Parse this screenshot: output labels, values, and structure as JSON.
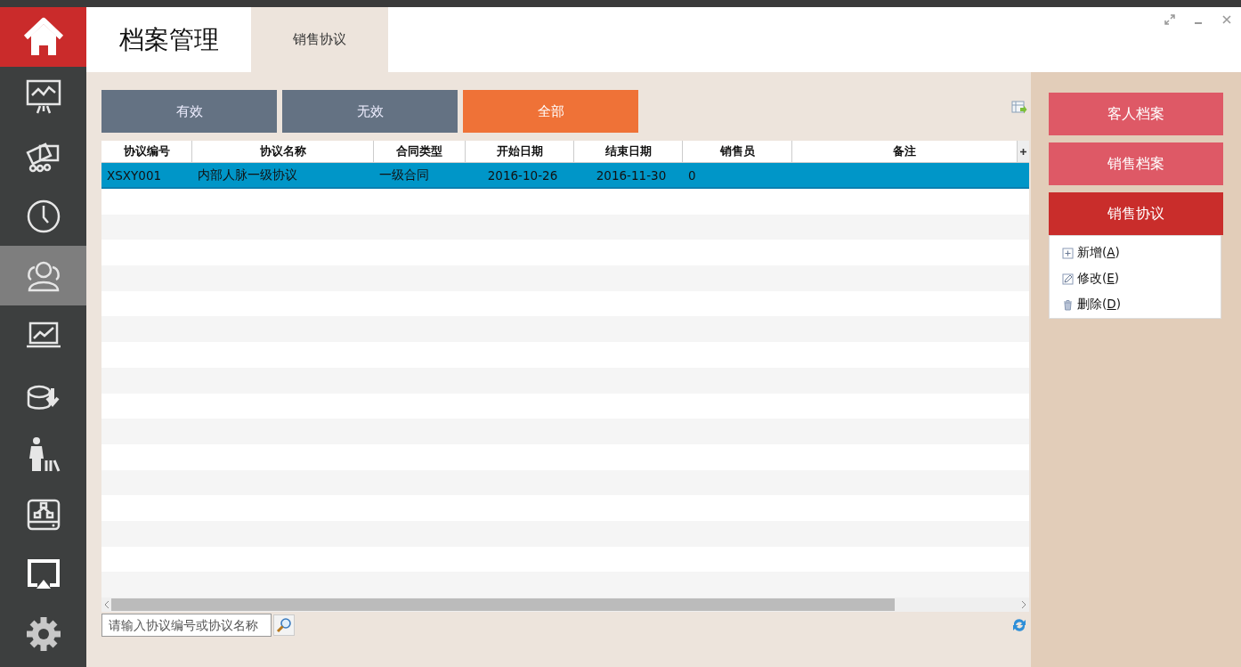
{
  "sidebar": {
    "items": [
      {
        "kind": "home"
      },
      {
        "kind": "nav",
        "selected": false
      },
      {
        "kind": "nav",
        "selected": false
      },
      {
        "kind": "nav",
        "selected": false
      },
      {
        "kind": "nav",
        "selected": true
      },
      {
        "kind": "nav",
        "selected": false
      },
      {
        "kind": "nav",
        "selected": false
      },
      {
        "kind": "nav",
        "selected": false
      },
      {
        "kind": "nav",
        "selected": false
      },
      {
        "kind": "nav",
        "selected": false
      },
      {
        "kind": "nav",
        "selected": false
      }
    ]
  },
  "header": {
    "title": "档案管理",
    "tabs": [
      {
        "label": "销售协议",
        "selected": true
      }
    ]
  },
  "filter_buttons": [
    {
      "label": "有效",
      "selected": false
    },
    {
      "label": "无效",
      "selected": false
    },
    {
      "label": "全部",
      "selected": true
    }
  ],
  "table": {
    "columns": [
      "协议编号",
      "协议名称",
      "合同类型",
      "开始日期",
      "结束日期",
      "销售员",
      "备注"
    ],
    "rows": [
      {
        "cells": [
          "XSXY001",
          "内部人脉一级协议",
          "一级合同",
          "2016-10-26",
          "2016-11-30",
          "0",
          ""
        ],
        "selected": true
      }
    ]
  },
  "search": {
    "placeholder": "请输入协议编号或协议名称"
  },
  "right_panel": {
    "nav": [
      {
        "label": "客人档案",
        "selected": false
      },
      {
        "label": "销售档案",
        "selected": false
      },
      {
        "label": "销售协议",
        "selected": true
      }
    ],
    "actions": [
      {
        "kind": "add",
        "before": "新增(",
        "key": "A",
        "after": ")"
      },
      {
        "kind": "edit",
        "before": "修改(",
        "key": "E",
        "after": ")"
      },
      {
        "kind": "delete",
        "before": "删除(",
        "key": "D",
        "after": ")"
      }
    ]
  }
}
